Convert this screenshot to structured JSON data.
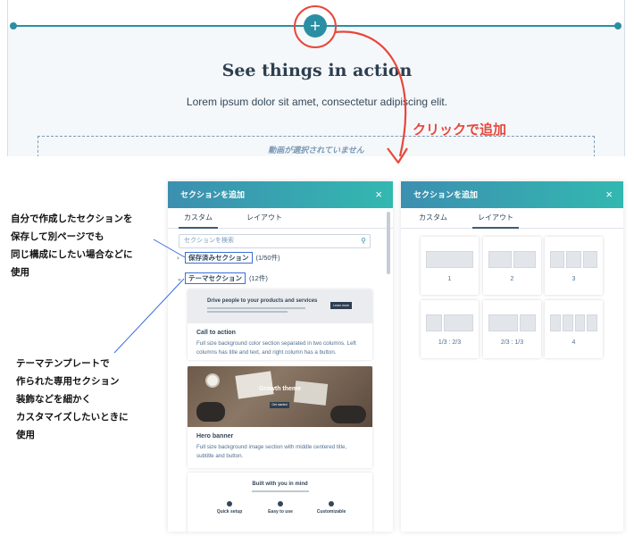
{
  "editor": {
    "add_symbol": "+",
    "title": "See things in action",
    "subtitle": "Lorem ipsum dolor sit amet, consectetur adipiscing elit.",
    "video_placeholder": "動画が選択されていません"
  },
  "annotation": {
    "click_to_add": "クリックで追加",
    "saved_note": "自分で作成したセクションを\n保存して別ページでも\n同じ構成にしたい場合などに\n使用",
    "theme_note": "テーマテンプレートで\n作られた専用セクション\n装飾などを細かく\nカスタマイズしたいときに\n使用",
    "accent_color": "#e8473b",
    "box_color": "#3a6fd8"
  },
  "panel_left": {
    "title": "セクションを追加",
    "close_icon": "×",
    "tabs": [
      {
        "label": "カスタム",
        "active": true
      },
      {
        "label": "レイアウト",
        "active": false
      }
    ],
    "search_placeholder": "セクションを検索",
    "saved_group": {
      "name": "保存済みセクション",
      "count": "(1/50件)"
    },
    "theme_group": {
      "name": "テーマセクション",
      "count": "(12件)"
    },
    "cards": [
      {
        "thumb_title": "Drive people to your products and services",
        "thumb_button": "Learn more",
        "title": "Call to action",
        "description": "Full size background color section separated in two columns. Left columns has title and text, and right column has a button."
      },
      {
        "thumb_title": "Growth theme",
        "thumb_button": "Get started",
        "title": "Hero banner",
        "description": "Full size background image section with middle centered title, subtitle and button."
      },
      {
        "thumb_title": "Built with you in mind",
        "features": [
          "Quick setup",
          "Easy to use",
          "Customizable"
        ]
      }
    ]
  },
  "panel_right": {
    "title": "セクションを追加",
    "close_icon": "×",
    "tabs": [
      {
        "label": "カスタム",
        "active": false
      },
      {
        "label": "レイアウト",
        "active": true
      }
    ],
    "layouts": [
      {
        "label": "1",
        "cols": 1
      },
      {
        "label": "2",
        "cols": 2
      },
      {
        "label": "3",
        "cols": 3
      },
      {
        "label": "1/3 : 2/3",
        "cols": 2
      },
      {
        "label": "2/3 : 1/3",
        "cols": 2
      },
      {
        "label": "4",
        "cols": 4
      }
    ]
  },
  "colors": {
    "teal": "#2a8fa3",
    "header_gradient_start": "#3c8fb0",
    "header_gradient_end": "#33b8b0"
  }
}
